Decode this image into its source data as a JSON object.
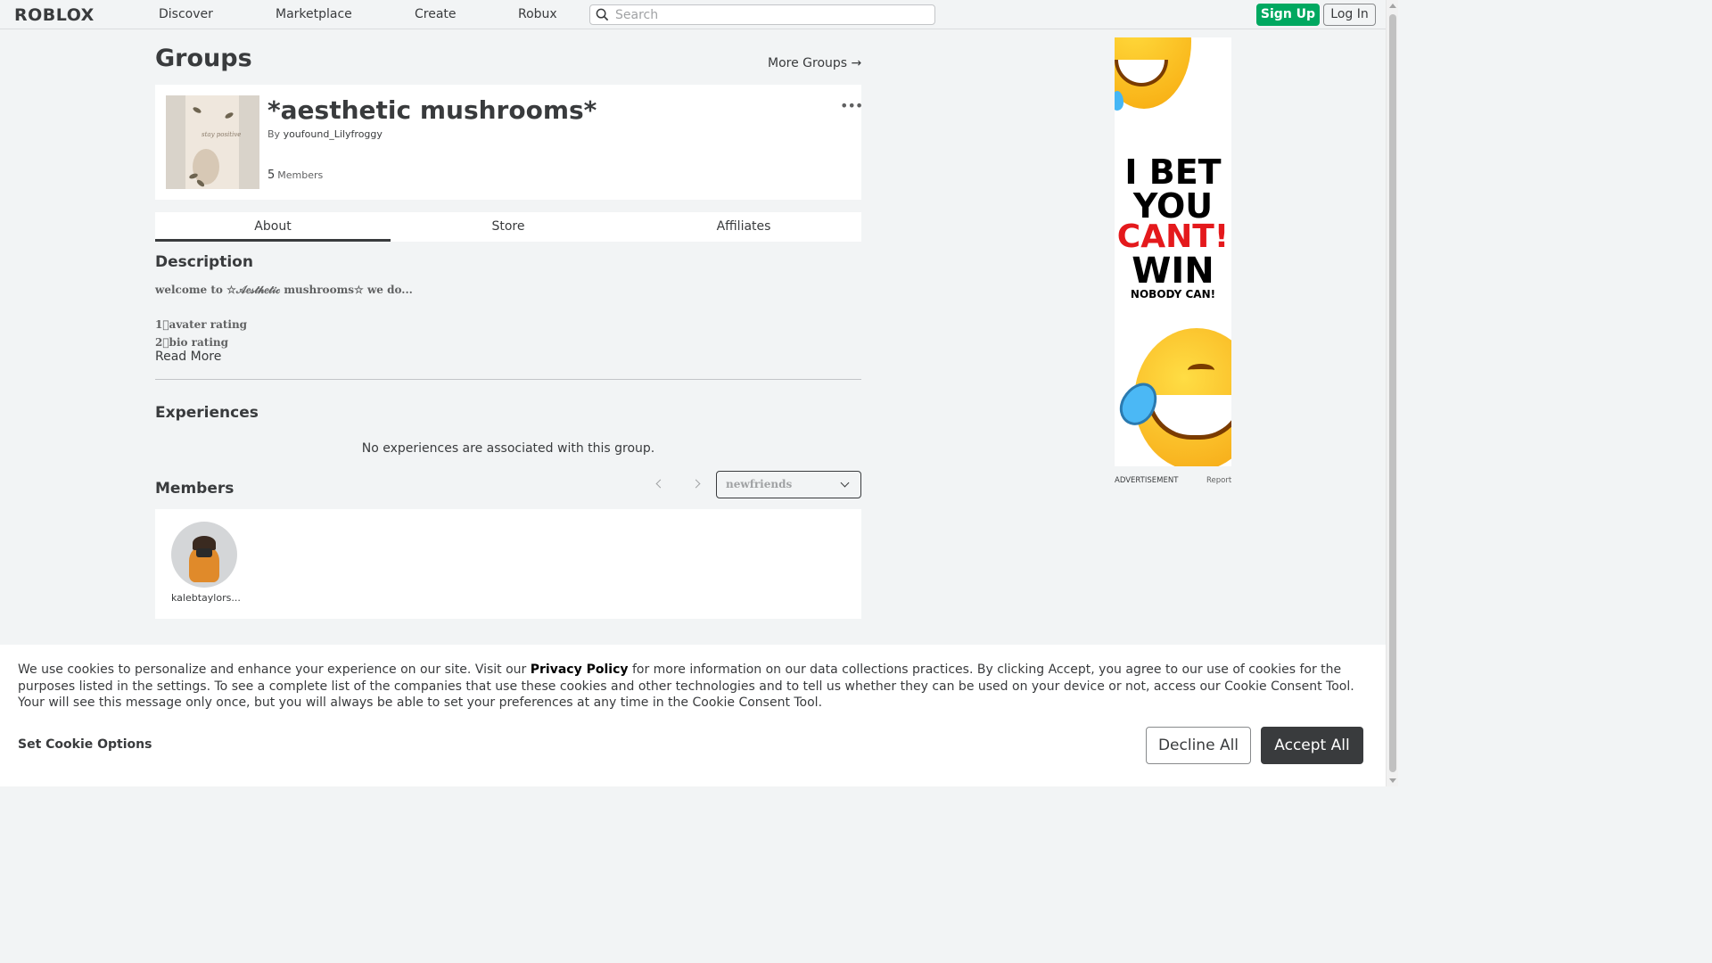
{
  "topbar": {
    "logo": "ROBLOX",
    "nav": [
      "Discover",
      "Marketplace",
      "Create",
      "Robux"
    ],
    "search_placeholder": "Search",
    "signup_label": "Sign Up",
    "login_label": "Log In"
  },
  "page": {
    "title": "Groups",
    "more_groups_label": "More Groups →"
  },
  "group": {
    "name": "*aesthetic mushrooms*",
    "by_prefix": "By",
    "owner": "youfound_Lilyfroggy",
    "member_count": "5",
    "members_label": "Members",
    "thumbnail_text": "stay positive"
  },
  "tabs": [
    "About",
    "Store",
    "Affiliates"
  ],
  "about": {
    "description_heading": "Description",
    "description_lines": [
      "welcome to ☆𝒜𝑒𝓈𝓉𝒽𝑒𝓉𝒾𝒸 mushrooms☆ we do...",
      "",
      "1⃣avater rating",
      "2⃣bio rating"
    ],
    "read_more": "Read More",
    "experiences_heading": "Experiences",
    "no_experiences": "No experiences are associated with this group.",
    "members_heading": "Members",
    "role_select_value": "newfriends",
    "members": [
      {
        "name": "kalebtaylors..."
      }
    ]
  },
  "ad": {
    "line1": "I BET",
    "line2": "YOU",
    "line3": "CANT!",
    "line4": "WIN",
    "line5": "NOBODY CAN!",
    "label": "ADVERTISEMENT",
    "report": "Report",
    "colors": {
      "red": "#e4191c"
    }
  },
  "cookie": {
    "text_1": "We use cookies to personalize and enhance your experience on our site. Visit our ",
    "privacy_link": "Privacy Policy",
    "text_2": " for more information on our data collections practices. By clicking Accept, you agree to our use of cookies for the purposes listed in the settings. To see a complete list of the companies that use these cookies and other technologies and to tell us whether they can be used on your device or not, access our Cookie Consent Tool. Your will see this message only once, but you will always be able to set your preferences at any time in the Cookie Consent Tool.",
    "set_options": "Set Cookie Options",
    "decline": "Decline All",
    "accept": "Accept All"
  },
  "colors": {
    "signup_green": "#00a860",
    "text_dark": "#393b3d",
    "page_bg": "#f2f4f5"
  }
}
